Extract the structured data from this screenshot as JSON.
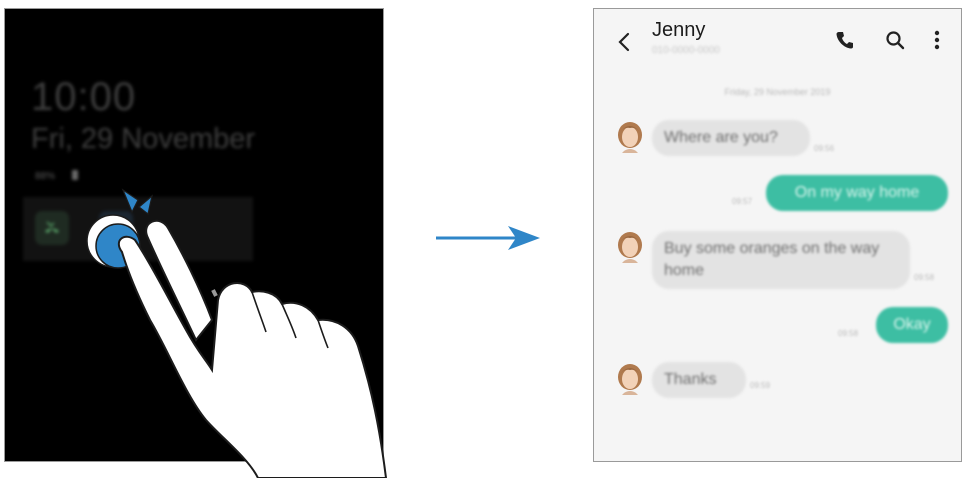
{
  "lock_screen": {
    "time": "10:00",
    "date": "Fri, 29 November",
    "battery_percent": "88%",
    "notifications": [
      {
        "icon": "missed-call-icon",
        "color": "#5aa66a"
      },
      {
        "icon": "message-icon",
        "color": "#4a7fa8"
      }
    ]
  },
  "chat": {
    "contact_name": "Jenny",
    "contact_number": "010-0000-0000",
    "date_divider": "Friday, 29 November 2019",
    "messages": [
      {
        "direction": "incoming",
        "text": "Where are you?",
        "time": "09:56"
      },
      {
        "direction": "outgoing",
        "text": "On my way home",
        "time": "09:57"
      },
      {
        "direction": "incoming",
        "text": "Buy some oranges on the way home",
        "time": "09:58"
      },
      {
        "direction": "outgoing",
        "text": "Okay",
        "time": "09:58"
      },
      {
        "direction": "incoming",
        "text": "Thanks",
        "time": "09:59"
      }
    ],
    "colors": {
      "outgoing_bubble": "#3dbea3",
      "incoming_bubble": "#e3e3e3",
      "background": "#f5f5f5"
    }
  },
  "arrow_color": "#2f86c8"
}
